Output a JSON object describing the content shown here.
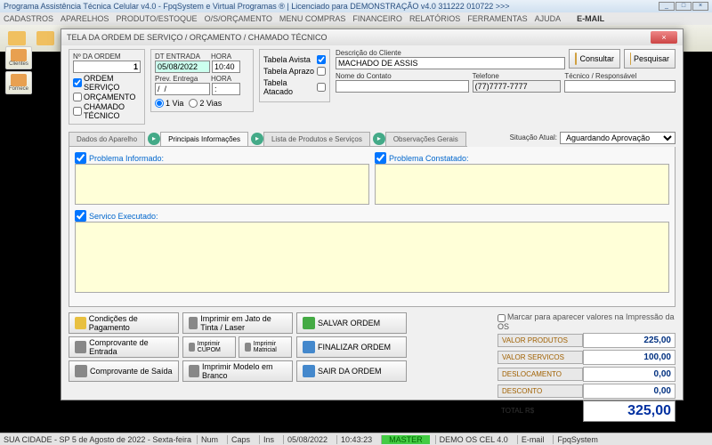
{
  "app": {
    "title": "Programa Assistência Técnica Celular v4.0 - FpqSystem e Virtual Programas ® | Licenciado para  DEMONSTRAÇÃO v4.0 311222 010722 >>>"
  },
  "menu": [
    "CADASTROS",
    "APARELHOS",
    "PRODUTO/ESTOQUE",
    "O/S/ORÇAMENTO",
    "MENU COMPRAS",
    "FINANCEIRO",
    "RELATÓRIOS",
    "FERRAMENTAS",
    "AJUDA"
  ],
  "menuEmail": "E-MAIL",
  "side": [
    {
      "label": "Clientes"
    },
    {
      "label": "Fornece"
    }
  ],
  "win": {
    "title": "TELA DA ORDEM DE SERVIÇO / ORÇAMENTO / CHAMADO TÉCNICO"
  },
  "order": {
    "numLabel": "Nº DA ORDEM",
    "num": "1",
    "chk1": "ORDEM SERVIÇO",
    "chk2": "ORÇAMENTO",
    "chk3": "CHAMADO TÉCNICO",
    "dtLabel": "DT ENTRADA",
    "hrLabel": "HORA",
    "dt": "05/08/2022",
    "hr": "10:40",
    "prevLabel": "Prev. Entrega",
    "prevHr": "HORA",
    "prevDt": "/  /",
    "prevH": ":",
    "via1": "1 Via",
    "via2": "2 Vias",
    "tAvista": "Tabela Avista",
    "tAprazo": "Tabela Aprazo",
    "tAtacado": "Tabela Atacado",
    "descLabel": "Descrição do Cliente",
    "desc": "MACHADO DE ASSIS",
    "contatoLabel": "Nome do Contato",
    "contato": "",
    "telLabel": "Telefone",
    "tel": "(77)7777-7777",
    "tecLabel": "Técnico / Responsável",
    "tec": "",
    "consultar": "Consultar",
    "pesquisar": "Pesquisar",
    "sitLabel": "Situação Atual:",
    "sit": "Aguardando Aprovação"
  },
  "tabs": [
    "Dados do Aparelho",
    "Principais Informações",
    "Lista de Produtos e Serviços",
    "Observações Gerais"
  ],
  "panels": {
    "probInf": "Problema Informado:",
    "probCon": "Problema Constatado:",
    "svc": "Servico Executado:"
  },
  "buttons": {
    "cond": "Condições de Pagamento",
    "entrada": "Comprovante de Entrada",
    "saida": "Comprovante de Saída",
    "jato": "Imprimir em Jato de Tinta / Laser",
    "cupom": "Imprimir CUPOM",
    "matricial": "Imprimir Matricial",
    "branco": "Imprimir Modelo em Branco",
    "salvar": "SALVAR ORDEM",
    "finalizar": "FINALIZAR ORDEM",
    "sair": "SAIR DA ORDEM"
  },
  "vals": {
    "hdr": "Marcar para aparecer valores na Impressão da OS",
    "prod": "VALOR PRODUTOS",
    "prodV": "225,00",
    "svc": "VALOR SERVICOS",
    "svcV": "100,00",
    "desloc": "DESLOCAMENTO",
    "deslocV": "0,00",
    "desc": "DESCONTO",
    "descV": "0,00",
    "tot": "TOTAL R$",
    "totV": "325,00"
  },
  "status": {
    "left": "SUA CIDADE - SP  5 de Agosto de 2022 - Sexta-feira",
    "num": "Num",
    "caps": "Caps",
    "ins": "Ins",
    "dt": "05/08/2022",
    "hr": "10:43:23",
    "master": "MASTER",
    "demo": "DEMO OS CEL 4.0",
    "email": "E-mail",
    "fpq": "FpqSystem"
  }
}
